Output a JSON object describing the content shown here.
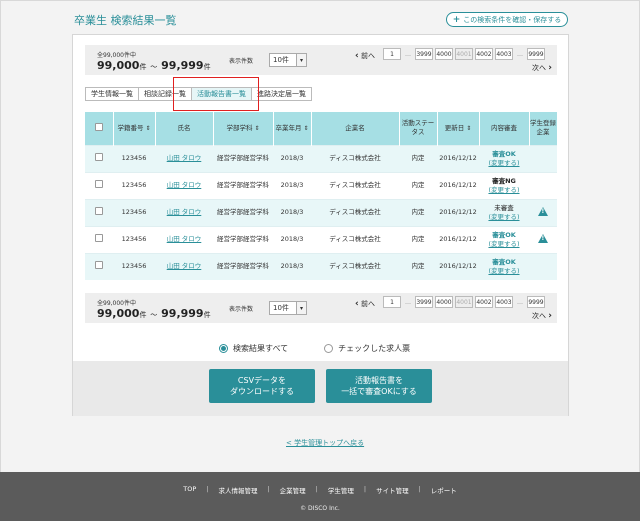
{
  "page": {
    "title": "卒業生 検索結果一覧",
    "save_button": "この検索条件を確認・保存する",
    "save_icon": "+"
  },
  "pager": {
    "count_small": "全99,000件中",
    "count_from": "99,000",
    "unit": "件",
    "range_sep": "～",
    "count_to": "99,999",
    "per_page_label": "表示件数",
    "per_page_value": "10件",
    "prev_label": "前へ",
    "prev_icon": "‹",
    "next_label": "次へ",
    "next_icon": "›",
    "pages": [
      "1",
      "…",
      "3999",
      "4000",
      "4001",
      "4002",
      "4003",
      "…",
      "9999"
    ],
    "current_page": "4001"
  },
  "tabs": [
    {
      "label": "学生情報一覧",
      "active": false
    },
    {
      "label": "相談記録一覧",
      "active": false
    },
    {
      "label": "活動報告書一覧",
      "active": true
    },
    {
      "label": "進路決定届一覧",
      "active": false
    }
  ],
  "table": {
    "headers": {
      "student_no": "学籍番号",
      "name": "氏名",
      "faculty": "学部学科",
      "grad_year": "卒業年月",
      "company": "企業名",
      "activity_status": "活動ステータス",
      "updated": "更新日",
      "review": "内容審査",
      "registered_company": "学生登録企業"
    },
    "rows": [
      {
        "student_no": "123456",
        "name": "山田 タロウ",
        "faculty": "経営学部経営学科",
        "grad_year": "2018/3",
        "company": "ディスコ株式会社",
        "status": "内定",
        "updated": "2016/12/12",
        "review": "審査OK",
        "review_type": "ok",
        "change_link": "(変更する)",
        "warning": false
      },
      {
        "student_no": "123456",
        "name": "山田 タロウ",
        "faculty": "経営学部経営学科",
        "grad_year": "2018/3",
        "company": "ディスコ株式会社",
        "status": "内定",
        "updated": "2016/12/12",
        "review": "審査NG",
        "review_type": "ng",
        "change_link": "(変更する)",
        "warning": false
      },
      {
        "student_no": "123456",
        "name": "山田 タロウ",
        "faculty": "経営学部経営学科",
        "grad_year": "2018/3",
        "company": "ディスコ株式会社",
        "status": "内定",
        "updated": "2016/12/12",
        "review": "未審査",
        "review_type": "none",
        "change_link": "(変更する)",
        "warning": true
      },
      {
        "student_no": "123456",
        "name": "山田 タロウ",
        "faculty": "経営学部経営学科",
        "grad_year": "2018/3",
        "company": "ディスコ株式会社",
        "status": "内定",
        "updated": "2016/12/12",
        "review": "審査OK",
        "review_type": "ok",
        "change_link": "(変更する)",
        "warning": true
      },
      {
        "student_no": "123456",
        "name": "山田 タロウ",
        "faculty": "経営学部経営学科",
        "grad_year": "2018/3",
        "company": "ディスコ株式会社",
        "status": "内定",
        "updated": "2016/12/12",
        "review": "審査OK",
        "review_type": "ok",
        "change_link": "(変更する)",
        "warning": false
      }
    ]
  },
  "radios": {
    "all_results": "検索結果すべて",
    "checked_only": "チェックした求人票",
    "selected": "all_results"
  },
  "actions": {
    "csv_line1": "CSVデータを",
    "csv_line2": "ダウンロードする",
    "approve_line1": "活動報告書を",
    "approve_line2": "一括で審査OKにする"
  },
  "back_link": "< 学生管理トップへ戻る",
  "footer": {
    "nav": [
      "TOP",
      "求人情報管理",
      "企業管理",
      "学生管理",
      "サイト管理",
      "レポート"
    ],
    "copyright": "© DISCO Inc."
  },
  "colors": {
    "accent": "#2a8f99",
    "header_bg": "#a6dfe4",
    "highlight": "#e02020"
  }
}
